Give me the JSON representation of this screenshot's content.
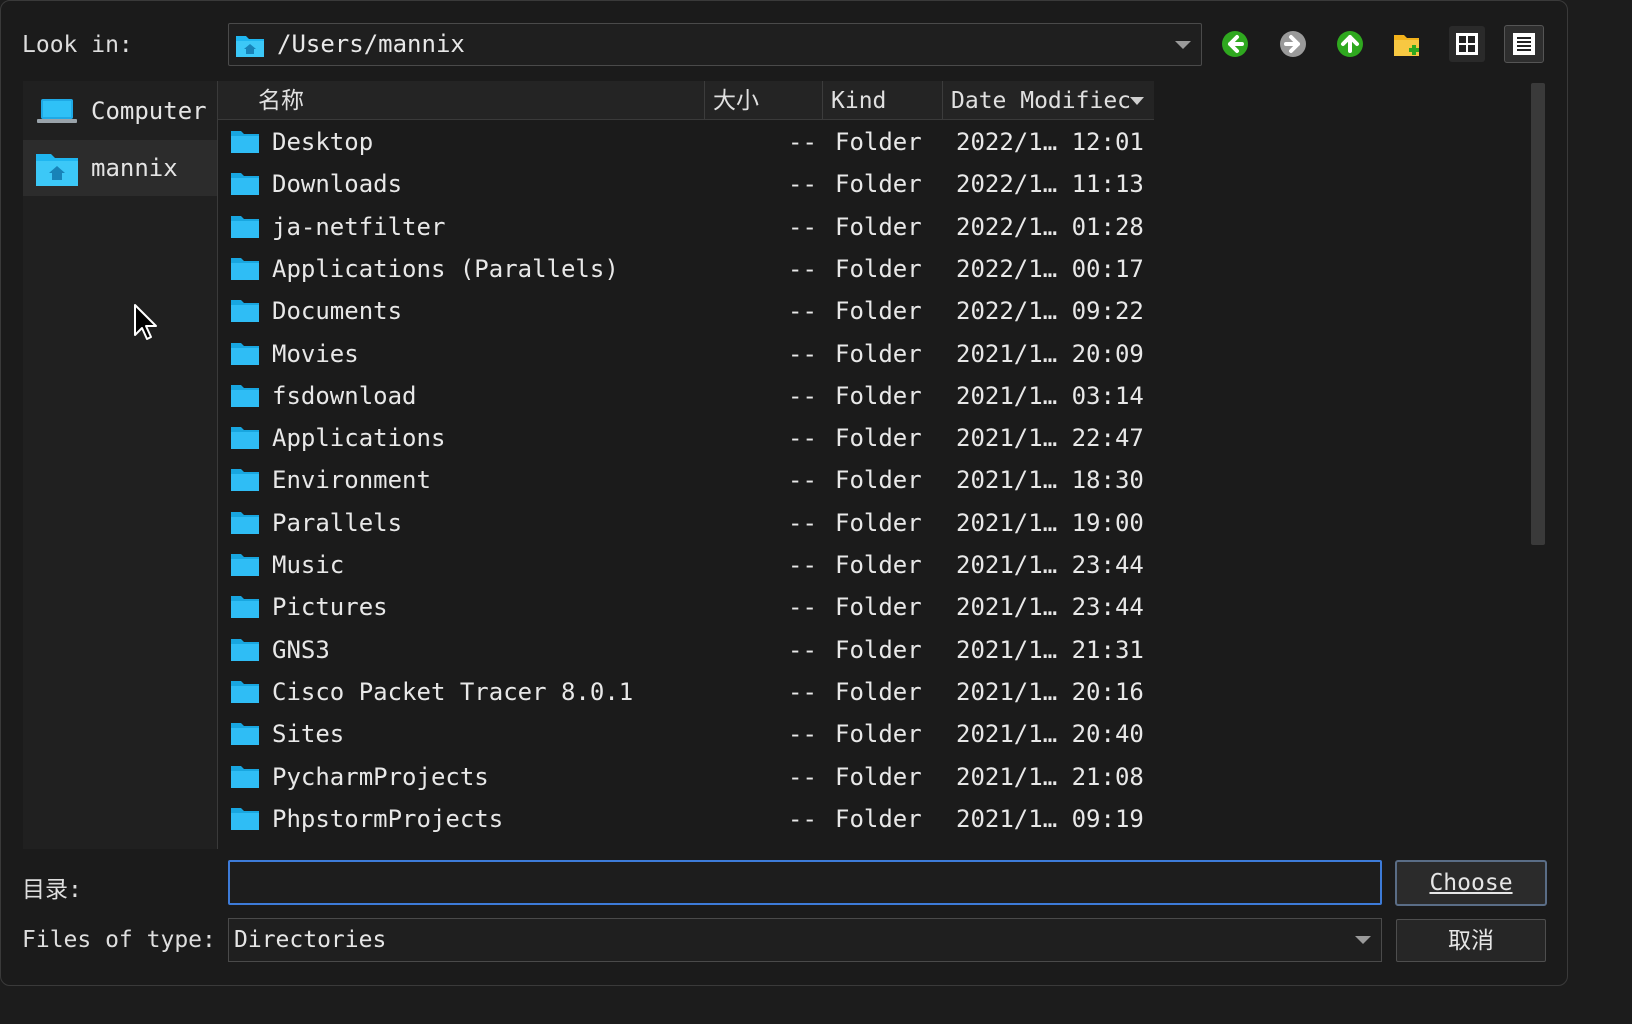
{
  "look_in": {
    "label": "Look in:",
    "path": "/Users/mannix"
  },
  "toolbar": {
    "back": "back-icon",
    "forward": "forward-icon",
    "up": "up-icon",
    "new_folder": "new-folder-icon",
    "icon_view": "grid-view-icon",
    "list_view": "list-view-icon"
  },
  "sidebar": {
    "items": [
      {
        "label": "Computer",
        "icon": "computer-icon"
      },
      {
        "label": "mannix",
        "icon": "home-folder-icon"
      }
    ]
  },
  "columns": {
    "name": "名称",
    "size": "大小",
    "kind": "Kind",
    "date": "Date Modifiec"
  },
  "files": [
    {
      "name": "Desktop",
      "size": "--",
      "kind": "Folder",
      "date": "2022/1… 12:01"
    },
    {
      "name": "Downloads",
      "size": "--",
      "kind": "Folder",
      "date": "2022/1… 11:13"
    },
    {
      "name": "ja-netfilter",
      "size": "--",
      "kind": "Folder",
      "date": "2022/1… 01:28"
    },
    {
      "name": "Applications (Parallels)",
      "size": "--",
      "kind": "Folder",
      "date": "2022/1… 00:17"
    },
    {
      "name": "Documents",
      "size": "--",
      "kind": "Folder",
      "date": "2022/1… 09:22"
    },
    {
      "name": "Movies",
      "size": "--",
      "kind": "Folder",
      "date": "2021/1… 20:09"
    },
    {
      "name": "fsdownload",
      "size": "--",
      "kind": "Folder",
      "date": "2021/1… 03:14"
    },
    {
      "name": "Applications",
      "size": "--",
      "kind": "Folder",
      "date": "2021/1… 22:47"
    },
    {
      "name": "Environment",
      "size": "--",
      "kind": "Folder",
      "date": "2021/1… 18:30"
    },
    {
      "name": "Parallels",
      "size": "--",
      "kind": "Folder",
      "date": "2021/1… 19:00"
    },
    {
      "name": "Music",
      "size": "--",
      "kind": "Folder",
      "date": "2021/1… 23:44"
    },
    {
      "name": "Pictures",
      "size": "--",
      "kind": "Folder",
      "date": "2021/1… 23:44"
    },
    {
      "name": "GNS3",
      "size": "--",
      "kind": "Folder",
      "date": "2021/1… 21:31"
    },
    {
      "name": "Cisco Packet Tracer 8.0.1",
      "size": "--",
      "kind": "Folder",
      "date": "2021/1… 20:16"
    },
    {
      "name": "Sites",
      "size": "--",
      "kind": "Folder",
      "date": "2021/1… 20:40"
    },
    {
      "name": "PycharmProjects",
      "size": "--",
      "kind": "Folder",
      "date": "2021/1… 21:08"
    },
    {
      "name": "PhpstormProjects",
      "size": "--",
      "kind": "Folder",
      "date": "2021/1… 09:19"
    }
  ],
  "directory": {
    "label": "目录:",
    "value": "",
    "placeholder": ""
  },
  "file_type": {
    "label": "Files of type:",
    "value": "Directories"
  },
  "buttons": {
    "choose": "Choose",
    "cancel": "取消"
  },
  "colors": {
    "folder": "#1fb6f0",
    "accent_border": "#3d7bd8",
    "back_arrow": "#3bbf2a"
  }
}
